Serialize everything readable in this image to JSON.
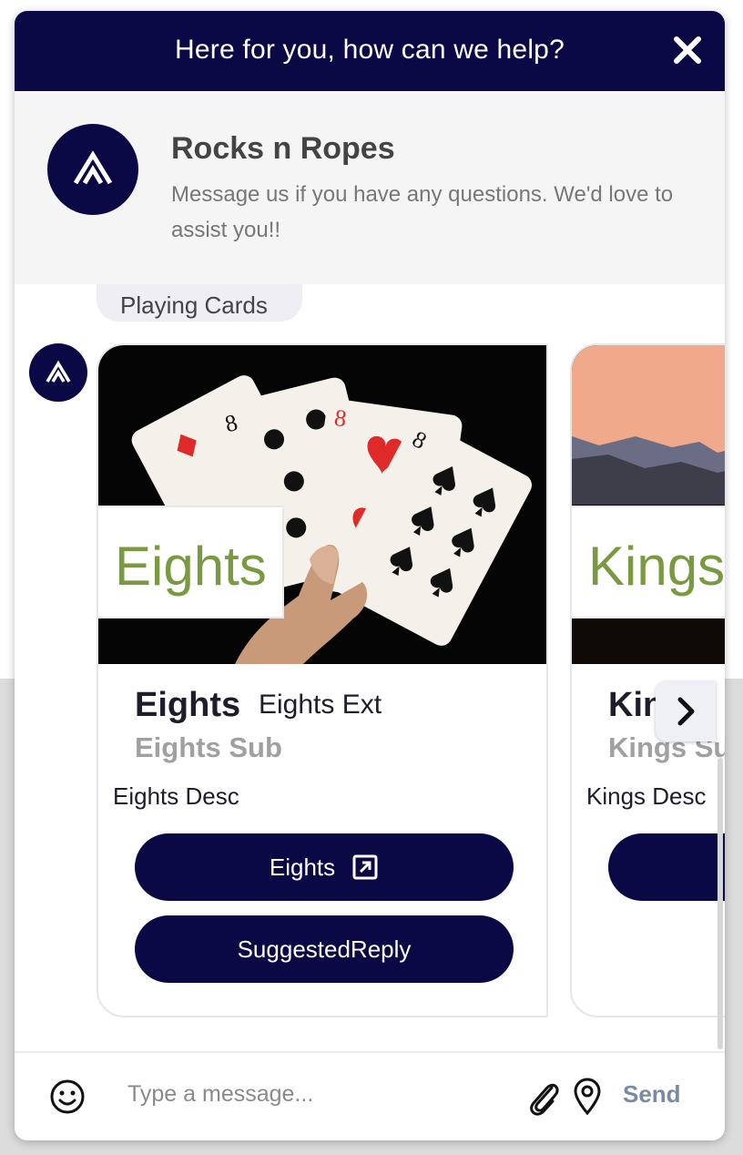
{
  "topbar": {
    "title": "Here for you, how can we help?"
  },
  "header": {
    "brand_name": "Rocks n Ropes",
    "message": "Message us if you have any questions. We'd love to assist you!!"
  },
  "chat": {
    "previous_reply": "Playing Cards",
    "cards": [
      {
        "image_label": "Eights",
        "title": "Eights",
        "title_ext": "Eights Ext",
        "subtitle": "Eights Sub",
        "description": "Eights Desc",
        "buttons": [
          {
            "label": "Eights",
            "icon": "external-link-icon"
          },
          {
            "label": "SuggestedReply"
          }
        ]
      },
      {
        "image_label": "Kings",
        "title": "Kings",
        "subtitle": "Kings Sub",
        "description": "Kings Desc"
      }
    ]
  },
  "composer": {
    "placeholder": "Type a message...",
    "send_label": "Send"
  },
  "colors": {
    "brand_navy": "#0a0845",
    "image_label_green": "#7a9a42",
    "send_gray": "#7a8aa3"
  }
}
